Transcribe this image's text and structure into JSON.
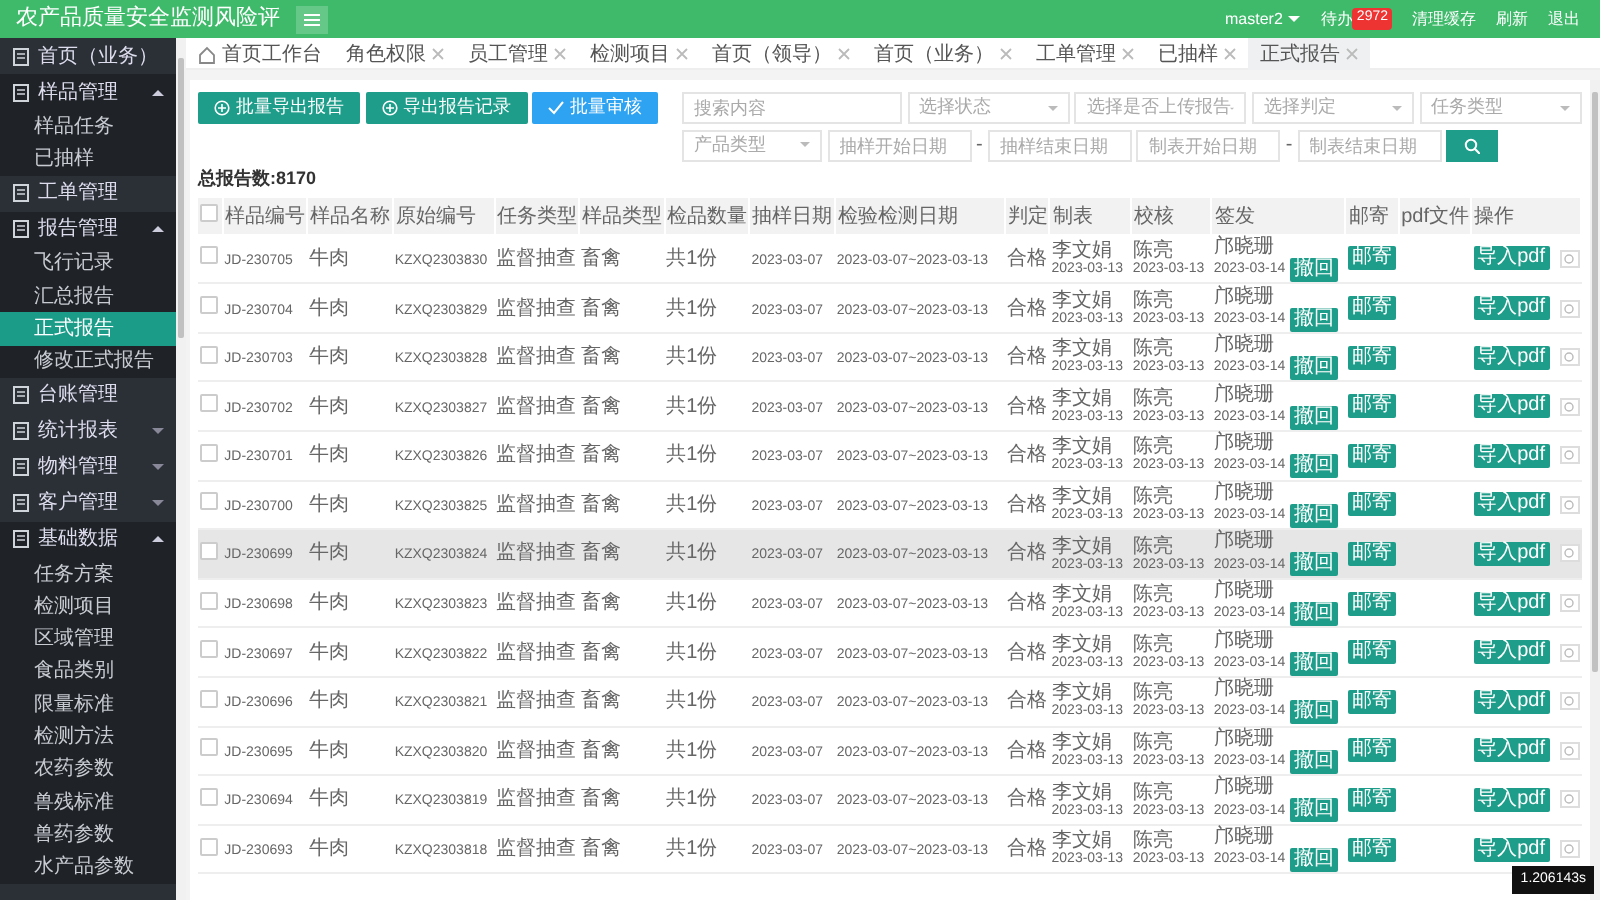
{
  "header": {
    "title": "农产品质量安全监测风险评",
    "user": "master2",
    "todo_label": "待办",
    "todo_count": "2972",
    "links": [
      "清理缓存",
      "刷新",
      "退出"
    ]
  },
  "sidebar": {
    "items": [
      {
        "label": "首页（业务）",
        "expanded": false,
        "has_caret": false
      },
      {
        "label": "样品管理",
        "expanded": true,
        "has_caret": true,
        "children": [
          {
            "label": "样品任务",
            "selected": false
          },
          {
            "label": "已抽样",
            "selected": false
          }
        ]
      },
      {
        "label": "工单管理",
        "expanded": false,
        "has_caret": false
      },
      {
        "label": "报告管理",
        "expanded": true,
        "has_caret": true,
        "children": [
          {
            "label": "飞行记录",
            "selected": false
          },
          {
            "label": "汇总报告",
            "selected": false
          },
          {
            "label": "正式报告",
            "selected": true
          },
          {
            "label": "修改正式报告",
            "selected": false
          }
        ]
      },
      {
        "label": "台账管理",
        "expanded": false,
        "has_caret": false
      },
      {
        "label": "统计报表",
        "expanded": false,
        "has_caret": true
      },
      {
        "label": "物料管理",
        "expanded": false,
        "has_caret": true
      },
      {
        "label": "客户管理",
        "expanded": false,
        "has_caret": true
      },
      {
        "label": "基础数据",
        "expanded": true,
        "has_caret": true,
        "children": [
          {
            "label": "任务方案",
            "selected": false
          },
          {
            "label": "检测项目",
            "selected": false
          },
          {
            "label": "区域管理",
            "selected": false
          },
          {
            "label": "食品类别",
            "selected": false
          },
          {
            "label": "限量标准",
            "selected": false
          },
          {
            "label": "检测方法",
            "selected": false
          },
          {
            "label": "农药参数",
            "selected": false
          },
          {
            "label": "兽残标准",
            "selected": false
          },
          {
            "label": "兽药参数",
            "selected": false
          },
          {
            "label": "水产品参数",
            "selected": false
          }
        ]
      }
    ]
  },
  "tabs": [
    {
      "label": "首页工作台",
      "selected": false,
      "closable": false
    },
    {
      "label": "角色权限",
      "selected": false,
      "closable": true
    },
    {
      "label": "员工管理",
      "selected": false,
      "closable": true
    },
    {
      "label": "检测项目",
      "selected": false,
      "closable": true
    },
    {
      "label": "首页（领导）",
      "selected": false,
      "closable": true
    },
    {
      "label": "首页（业务）",
      "selected": false,
      "closable": true
    },
    {
      "label": "工单管理",
      "selected": false,
      "closable": true
    },
    {
      "label": "已抽样",
      "selected": false,
      "closable": true
    },
    {
      "label": "正式报告",
      "selected": true,
      "closable": true
    }
  ],
  "actions": [
    {
      "label": "批量导出报告",
      "kind": "export"
    },
    {
      "label": "导出报告记录",
      "kind": "export"
    },
    {
      "label": "批量审核",
      "kind": "approve"
    }
  ],
  "filters": {
    "row_1": [
      {
        "placeholder": "搜索内容",
        "kind": "input"
      },
      {
        "placeholder": "选择状态",
        "kind": "select"
      },
      {
        "placeholder": "选择是否上传报告",
        "kind": "select"
      },
      {
        "placeholder": "选择判定",
        "kind": "select"
      },
      {
        "placeholder": "任务类型",
        "kind": "select"
      }
    ],
    "row_2": [
      {
        "placeholder": "产品类型",
        "kind": "select"
      },
      {
        "placeholder": "抽样开始日期",
        "kind": "input"
      },
      {
        "placeholder": "抽样结束日期",
        "kind": "input"
      },
      {
        "placeholder": "制表开始日期",
        "kind": "input"
      },
      {
        "placeholder": "制表结束日期",
        "kind": "input"
      }
    ],
    "range_separator": "-"
  },
  "total": "总报告数:8170",
  "table": {
    "select_all_checked": false,
    "columns": [
      "样品编号",
      "样品名称",
      "原始编号",
      "任务类型",
      "样品类型",
      "检品数量",
      "抽样日期",
      "检验检测日期",
      "判定",
      "制表",
      "校核",
      "签发",
      "邮寄",
      "pdf文件",
      "操作"
    ],
    "rows": [
      {
        "sample_no": "JD-230705",
        "sample_name": "牛肉",
        "original_no": "KZXQ2303830",
        "task_type": "监督抽查",
        "sample_type": "畜禽",
        "quantity": "共1份",
        "sampling_date": "2023-03-07",
        "test_period": "2023-03-07~2023-03-13",
        "verdict": "合格",
        "prepared": [
          "李文娟",
          "2023-03-13"
        ],
        "checked_by": [
          "陈亮",
          "2023-03-13"
        ],
        "issued": [
          "邝晓珊",
          "2023-03-14"
        ],
        "withdraw": "撤回",
        "mail": "邮寄",
        "import": "导入pdf",
        "checked": false,
        "highlighted": false
      },
      {
        "sample_no": "JD-230704",
        "sample_name": "牛肉",
        "original_no": "KZXQ2303829",
        "task_type": "监督抽查",
        "sample_type": "畜禽",
        "quantity": "共1份",
        "sampling_date": "2023-03-07",
        "test_period": "2023-03-07~2023-03-13",
        "verdict": "合格",
        "prepared": [
          "李文娟",
          "2023-03-13"
        ],
        "checked_by": [
          "陈亮",
          "2023-03-13"
        ],
        "issued": [
          "邝晓珊",
          "2023-03-14"
        ],
        "withdraw": "撤回",
        "mail": "邮寄",
        "import": "导入pdf",
        "checked": false,
        "highlighted": false
      },
      {
        "sample_no": "JD-230703",
        "sample_name": "牛肉",
        "original_no": "KZXQ2303828",
        "task_type": "监督抽查",
        "sample_type": "畜禽",
        "quantity": "共1份",
        "sampling_date": "2023-03-07",
        "test_period": "2023-03-07~2023-03-13",
        "verdict": "合格",
        "prepared": [
          "李文娟",
          "2023-03-13"
        ],
        "checked_by": [
          "陈亮",
          "2023-03-13"
        ],
        "issued": [
          "邝晓珊",
          "2023-03-14"
        ],
        "withdraw": "撤回",
        "mail": "邮寄",
        "import": "导入pdf",
        "checked": false,
        "highlighted": false
      },
      {
        "sample_no": "JD-230702",
        "sample_name": "牛肉",
        "original_no": "KZXQ2303827",
        "task_type": "监督抽查",
        "sample_type": "畜禽",
        "quantity": "共1份",
        "sampling_date": "2023-03-07",
        "test_period": "2023-03-07~2023-03-13",
        "verdict": "合格",
        "prepared": [
          "李文娟",
          "2023-03-13"
        ],
        "checked_by": [
          "陈亮",
          "2023-03-13"
        ],
        "issued": [
          "邝晓珊",
          "2023-03-14"
        ],
        "withdraw": "撤回",
        "mail": "邮寄",
        "import": "导入pdf",
        "checked": false,
        "highlighted": false
      },
      {
        "sample_no": "JD-230701",
        "sample_name": "牛肉",
        "original_no": "KZXQ2303826",
        "task_type": "监督抽查",
        "sample_type": "畜禽",
        "quantity": "共1份",
        "sampling_date": "2023-03-07",
        "test_period": "2023-03-07~2023-03-13",
        "verdict": "合格",
        "prepared": [
          "李文娟",
          "2023-03-13"
        ],
        "checked_by": [
          "陈亮",
          "2023-03-13"
        ],
        "issued": [
          "邝晓珊",
          "2023-03-14"
        ],
        "withdraw": "撤回",
        "mail": "邮寄",
        "import": "导入pdf",
        "checked": false,
        "highlighted": false
      },
      {
        "sample_no": "JD-230700",
        "sample_name": "牛肉",
        "original_no": "KZXQ2303825",
        "task_type": "监督抽查",
        "sample_type": "畜禽",
        "quantity": "共1份",
        "sampling_date": "2023-03-07",
        "test_period": "2023-03-07~2023-03-13",
        "verdict": "合格",
        "prepared": [
          "李文娟",
          "2023-03-13"
        ],
        "checked_by": [
          "陈亮",
          "2023-03-13"
        ],
        "issued": [
          "邝晓珊",
          "2023-03-14"
        ],
        "withdraw": "撤回",
        "mail": "邮寄",
        "import": "导入pdf",
        "checked": false,
        "highlighted": false
      },
      {
        "sample_no": "JD-230699",
        "sample_name": "牛肉",
        "original_no": "KZXQ2303824",
        "task_type": "监督抽查",
        "sample_type": "畜禽",
        "quantity": "共1份",
        "sampling_date": "2023-03-07",
        "test_period": "2023-03-07~2023-03-13",
        "verdict": "合格",
        "prepared": [
          "李文娟",
          "2023-03-13"
        ],
        "checked_by": [
          "陈亮",
          "2023-03-13"
        ],
        "issued": [
          "邝晓珊",
          "2023-03-14"
        ],
        "withdraw": "撤回",
        "mail": "邮寄",
        "import": "导入pdf",
        "checked": false,
        "highlighted": true
      },
      {
        "sample_no": "JD-230698",
        "sample_name": "牛肉",
        "original_no": "KZXQ2303823",
        "task_type": "监督抽查",
        "sample_type": "畜禽",
        "quantity": "共1份",
        "sampling_date": "2023-03-07",
        "test_period": "2023-03-07~2023-03-13",
        "verdict": "合格",
        "prepared": [
          "李文娟",
          "2023-03-13"
        ],
        "checked_by": [
          "陈亮",
          "2023-03-13"
        ],
        "issued": [
          "邝晓珊",
          "2023-03-14"
        ],
        "withdraw": "撤回",
        "mail": "邮寄",
        "import": "导入pdf",
        "checked": false,
        "highlighted": false
      },
      {
        "sample_no": "JD-230697",
        "sample_name": "牛肉",
        "original_no": "KZXQ2303822",
        "task_type": "监督抽查",
        "sample_type": "畜禽",
        "quantity": "共1份",
        "sampling_date": "2023-03-07",
        "test_period": "2023-03-07~2023-03-13",
        "verdict": "合格",
        "prepared": [
          "李文娟",
          "2023-03-13"
        ],
        "checked_by": [
          "陈亮",
          "2023-03-13"
        ],
        "issued": [
          "邝晓珊",
          "2023-03-14"
        ],
        "withdraw": "撤回",
        "mail": "邮寄",
        "import": "导入pdf",
        "checked": false,
        "highlighted": false
      },
      {
        "sample_no": "JD-230696",
        "sample_name": "牛肉",
        "original_no": "KZXQ2303821",
        "task_type": "监督抽查",
        "sample_type": "畜禽",
        "quantity": "共1份",
        "sampling_date": "2023-03-07",
        "test_period": "2023-03-07~2023-03-13",
        "verdict": "合格",
        "prepared": [
          "李文娟",
          "2023-03-13"
        ],
        "checked_by": [
          "陈亮",
          "2023-03-13"
        ],
        "issued": [
          "邝晓珊",
          "2023-03-14"
        ],
        "withdraw": "撤回",
        "mail": "邮寄",
        "import": "导入pdf",
        "checked": false,
        "highlighted": false
      },
      {
        "sample_no": "JD-230695",
        "sample_name": "牛肉",
        "original_no": "KZXQ2303820",
        "task_type": "监督抽查",
        "sample_type": "畜禽",
        "quantity": "共1份",
        "sampling_date": "2023-03-07",
        "test_period": "2023-03-07~2023-03-13",
        "verdict": "合格",
        "prepared": [
          "李文娟",
          "2023-03-13"
        ],
        "checked_by": [
          "陈亮",
          "2023-03-13"
        ],
        "issued": [
          "邝晓珊",
          "2023-03-14"
        ],
        "withdraw": "撤回",
        "mail": "邮寄",
        "import": "导入pdf",
        "checked": false,
        "highlighted": false
      },
      {
        "sample_no": "JD-230694",
        "sample_name": "牛肉",
        "original_no": "KZXQ2303819",
        "task_type": "监督抽查",
        "sample_type": "畜禽",
        "quantity": "共1份",
        "sampling_date": "2023-03-07",
        "test_period": "2023-03-07~2023-03-13",
        "verdict": "合格",
        "prepared": [
          "李文娟",
          "2023-03-13"
        ],
        "checked_by": [
          "陈亮",
          "2023-03-13"
        ],
        "issued": [
          "邝晓珊",
          "2023-03-14"
        ],
        "withdraw": "撤回",
        "mail": "邮寄",
        "import": "导入pdf",
        "checked": false,
        "highlighted": false
      },
      {
        "sample_no": "JD-230693",
        "sample_name": "牛肉",
        "original_no": "KZXQ2303818",
        "task_type": "监督抽查",
        "sample_type": "畜禽",
        "quantity": "共1份",
        "sampling_date": "2023-03-07",
        "test_period": "2023-03-07~2023-03-13",
        "verdict": "合格",
        "prepared": [
          "李文娟",
          "2023-03-13"
        ],
        "checked_by": [
          "陈亮",
          "2023-03-13"
        ],
        "issued": [
          "邝晓珊",
          "2023-03-14"
        ],
        "withdraw": "撤回",
        "mail": "邮寄",
        "import": "导入pdf",
        "checked": false,
        "highlighted": false
      }
    ]
  },
  "load_time": "1.206143s"
}
